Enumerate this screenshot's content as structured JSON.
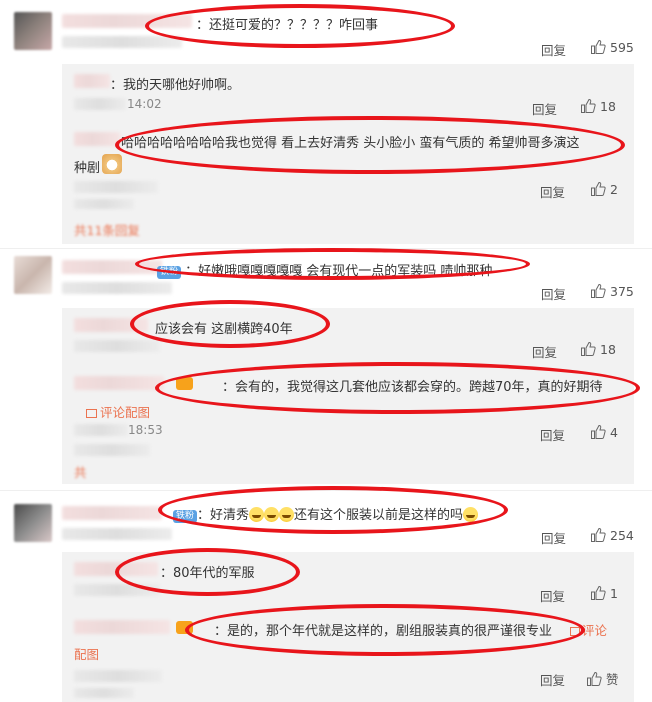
{
  "actions": {
    "reply": "回复",
    "like_zero": "赞"
  },
  "comments": [
    {
      "text": "：还挺可爱的？？？？？咋回事",
      "likes": "595",
      "replies": [
        {
          "text": "：我的天哪他好帅啊。",
          "time": "14:02",
          "likes": "18"
        },
        {
          "text": "哈哈哈哈哈哈哈哈我也觉得 看上去好清秀 头小脸小 蛮有气质的 希望帅哥多演这",
          "text2": "种剧",
          "likes": "2"
        }
      ],
      "more": "共11条回复"
    },
    {
      "badge": "铁粉",
      "text": "：好嫩哦嘎嘎嘎嘎嘎 会有现代一点的军装吗 啧帅那种",
      "likes": "375",
      "replies": [
        {
          "text": "应该会有 这剧横跨40年",
          "likes": "18"
        },
        {
          "text": "：会有的，我觉得这几套他应该都会穿的。跨越70年，真的好期待",
          "pic": "评论配图",
          "time": "18:53",
          "likes": "4"
        }
      ],
      "more": "共"
    },
    {
      "badge": "铁粉",
      "text": "：好清秀",
      "text_after": "还有这个服装以前是这样的吗",
      "likes": "254",
      "replies": [
        {
          "text": "：80年代的军服",
          "likes": "1"
        },
        {
          "text": "：是的，那个年代就是这样的，剧组服装真的很严谨很专业",
          "pic_a": "评论",
          "pic_b": "配图"
        }
      ]
    }
  ],
  "colors": {
    "annotation": "#e8151b",
    "link": "#eb7350",
    "sub_bg": "#f2f2f2",
    "badge": "#5aa1e3"
  }
}
